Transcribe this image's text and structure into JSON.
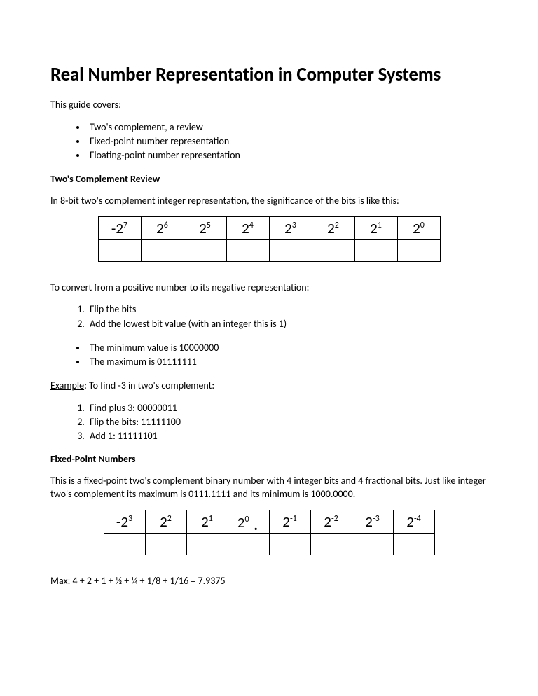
{
  "title": "Real Number Representation in Computer Systems",
  "intro": "This guide covers:",
  "covers": [
    "Two's complement, a review",
    "Fixed-point number representation",
    "Floating-point number representation"
  ],
  "section1_head": "Two's Complement Review",
  "section1_text": "In 8-bit two's complement integer representation, the significance of the bits is like this:",
  "bits8": [
    {
      "base": "-2",
      "exp": "7"
    },
    {
      "base": "2",
      "exp": "6"
    },
    {
      "base": "2",
      "exp": "5"
    },
    {
      "base": "2",
      "exp": "4"
    },
    {
      "base": "2",
      "exp": "3"
    },
    {
      "base": "2",
      "exp": "2"
    },
    {
      "base": "2",
      "exp": "1"
    },
    {
      "base": "2",
      "exp": "0"
    }
  ],
  "convert_intro": "To convert from a positive number to its negative representation:",
  "convert_steps": [
    "Flip the bits",
    "Add the lowest bit value (with an integer this is 1)"
  ],
  "minmax": [
    "The minimum value is 10000000",
    "The maximum is 01111111"
  ],
  "example_label": "Example",
  "example_tail": ": To find -3 in two's complement:",
  "example_steps": [
    "Find plus 3: 00000011",
    "Flip the bits: 11111100",
    "Add 1: 11111101"
  ],
  "section2_head": "Fixed-Point Numbers",
  "section2_text": "This is a fixed-point two's complement binary number with 4 integer bits and 4 fractional bits. Just like integer two's complement its maximum is 0111.1111 and its minimum is 1000.0000.",
  "fixed_bits": [
    {
      "base": "-2",
      "exp": "3"
    },
    {
      "base": "2",
      "exp": "2"
    },
    {
      "base": "2",
      "exp": "1"
    },
    {
      "base": "2",
      "exp": "0",
      "dot": true
    },
    {
      "base": "2",
      "exp": "-1"
    },
    {
      "base": "2",
      "exp": "-2"
    },
    {
      "base": "2",
      "exp": "-3"
    },
    {
      "base": "2",
      "exp": "-4"
    }
  ],
  "max_line": "Max: 4 + 2 + 1 + ½ + ¼ + 1/8 + 1/16 = 7.9375"
}
